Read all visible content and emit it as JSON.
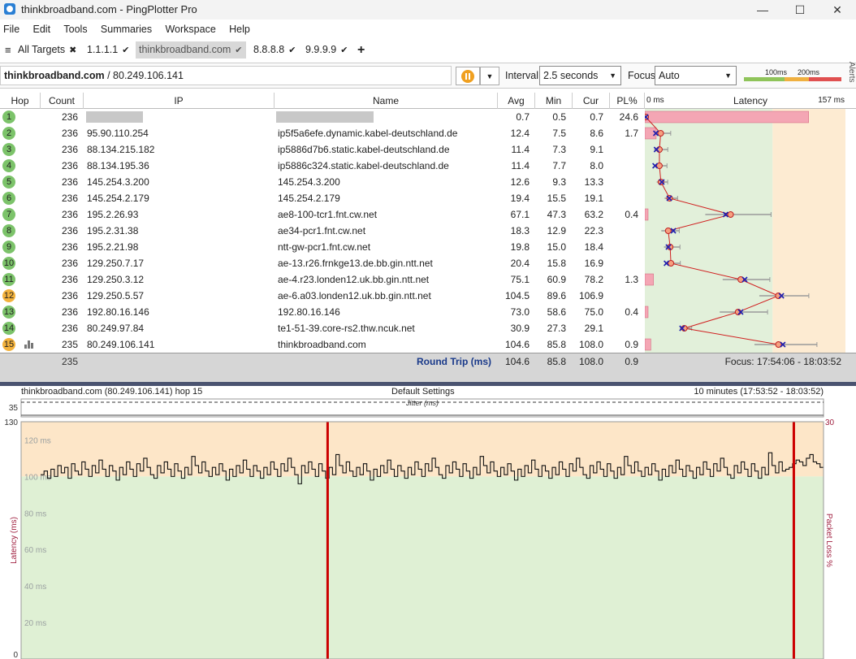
{
  "window": {
    "title": "thinkbroadband.com - PingPlotter Pro",
    "minimize": "—",
    "maximize": "☐",
    "close": "✕"
  },
  "menu": [
    "File",
    "Edit",
    "Tools",
    "Summaries",
    "Workspace",
    "Help"
  ],
  "tabs": [
    {
      "label": "All Targets",
      "icon": "✖"
    },
    {
      "label": "1.1.1.1",
      "icon": "✔"
    },
    {
      "label": "thinkbroadband.com",
      "icon": "✔"
    },
    {
      "label": "8.8.8.8",
      "icon": "✔"
    },
    {
      "label": "9.9.9.9",
      "icon": "✔"
    },
    {
      "label": "+",
      "icon": ""
    }
  ],
  "target": {
    "host": "thinkbroadband.com",
    "ip": " / 80.249.106.141",
    "interval_label": "Interval",
    "interval_value": "2.5 seconds",
    "focus_label": "Focus",
    "focus_value": "Auto",
    "scale_100": "100ms",
    "scale_200": "200ms",
    "alerts": "Alerts"
  },
  "colors": {
    "green": "#6cbf4c",
    "orange": "#f0b030",
    "red": "#e04040",
    "latency_green": "#e2f0da",
    "latency_orange": "#fdebd2",
    "graph_line": "#cc0000"
  },
  "table": {
    "headers": {
      "hop": "Hop",
      "count": "Count",
      "ip": "IP",
      "name": "Name",
      "avg": "Avg",
      "min": "Min",
      "cur": "Cur",
      "pl": "PL%",
      "latency": "Latency"
    },
    "latency_min_label": "0 ms",
    "latency_max_label": "157 ms",
    "rows": [
      {
        "hop": "1",
        "count": "236",
        "ip": "",
        "name": "",
        "avg": "0.7",
        "min": "0.5",
        "cur": "0.7",
        "pl": "24.6",
        "status": "green",
        "redacted": true
      },
      {
        "hop": "2",
        "count": "236",
        "ip": "95.90.110.254",
        "name": "ip5f5a6efe.dynamic.kabel-deutschland.de",
        "avg": "12.4",
        "min": "7.5",
        "cur": "8.6",
        "pl": "1.7",
        "status": "green"
      },
      {
        "hop": "3",
        "count": "236",
        "ip": "88.134.215.182",
        "name": "ip5886d7b6.static.kabel-deutschland.de",
        "avg": "11.4",
        "min": "7.3",
        "cur": "9.1",
        "pl": "",
        "status": "green"
      },
      {
        "hop": "4",
        "count": "236",
        "ip": "88.134.195.36",
        "name": "ip5886c324.static.kabel-deutschland.de",
        "avg": "11.4",
        "min": "7.7",
        "cur": "8.0",
        "pl": "",
        "status": "green"
      },
      {
        "hop": "5",
        "count": "236",
        "ip": "145.254.3.200",
        "name": "145.254.3.200",
        "avg": "12.6",
        "min": "9.3",
        "cur": "13.3",
        "pl": "",
        "status": "green"
      },
      {
        "hop": "6",
        "count": "236",
        "ip": "145.254.2.179",
        "name": "145.254.2.179",
        "avg": "19.4",
        "min": "15.5",
        "cur": "19.1",
        "pl": "",
        "status": "green"
      },
      {
        "hop": "7",
        "count": "236",
        "ip": "195.2.26.93",
        "name": "ae8-100-tcr1.fnt.cw.net",
        "avg": "67.1",
        "min": "47.3",
        "cur": "63.2",
        "pl": "0.4",
        "status": "green"
      },
      {
        "hop": "8",
        "count": "236",
        "ip": "195.2.31.38",
        "name": "ae34-pcr1.fnt.cw.net",
        "avg": "18.3",
        "min": "12.9",
        "cur": "22.3",
        "pl": "",
        "status": "green"
      },
      {
        "hop": "9",
        "count": "236",
        "ip": "195.2.21.98",
        "name": "ntt-gw-pcr1.fnt.cw.net",
        "avg": "19.8",
        "min": "15.0",
        "cur": "18.4",
        "pl": "",
        "status": "green"
      },
      {
        "hop": "10",
        "count": "236",
        "ip": "129.250.7.17",
        "name": "ae-13.r26.frnkge13.de.bb.gin.ntt.net",
        "avg": "20.4",
        "min": "15.8",
        "cur": "16.9",
        "pl": "",
        "status": "green"
      },
      {
        "hop": "11",
        "count": "236",
        "ip": "129.250.3.12",
        "name": "ae-4.r23.londen12.uk.bb.gin.ntt.net",
        "avg": "75.1",
        "min": "60.9",
        "cur": "78.2",
        "pl": "1.3",
        "status": "green"
      },
      {
        "hop": "12",
        "count": "236",
        "ip": "129.250.5.57",
        "name": "ae-6.a03.londen12.uk.bb.gin.ntt.net",
        "avg": "104.5",
        "min": "89.6",
        "cur": "106.9",
        "pl": "",
        "status": "orange"
      },
      {
        "hop": "13",
        "count": "236",
        "ip": "192.80.16.146",
        "name": "192.80.16.146",
        "avg": "73.0",
        "min": "58.6",
        "cur": "75.0",
        "pl": "0.4",
        "status": "green"
      },
      {
        "hop": "14",
        "count": "236",
        "ip": "80.249.97.84",
        "name": "te1-51-39.core-rs2.thw.ncuk.net",
        "avg": "30.9",
        "min": "27.3",
        "cur": "29.1",
        "pl": "",
        "status": "green"
      },
      {
        "hop": "15",
        "count": "235",
        "ip": "80.249.106.141",
        "name": "thinkbroadband.com",
        "avg": "104.6",
        "min": "85.8",
        "cur": "108.0",
        "pl": "0.9",
        "status": "orange",
        "graph_icon": true
      }
    ],
    "footer": {
      "count": "235",
      "label": "Round Trip (ms)",
      "avg": "104.6",
      "min": "85.8",
      "cur": "108.0",
      "pl": "0.9",
      "focus": "Focus: 17:54:06 - 18:03:52"
    }
  },
  "graph": {
    "title_left": "thinkbroadband.com (80.249.106.141) hop 15",
    "title_center": "Default Settings",
    "title_right": "10 minutes (17:53:52 - 18:03:52)",
    "jitter_label": "Jitter (ms)",
    "jitter_max": "35",
    "y_max": "130",
    "y_min": "0",
    "pl_max": "30",
    "y_axis_label": "Latency (ms)",
    "pl_axis_label": "Packet Loss %",
    "gridlines": [
      "120 ms",
      "100 ms",
      "80 ms",
      "60 ms",
      "40 ms",
      "20 ms"
    ]
  },
  "chart_data": {
    "type": "line",
    "ylabel": "Latency (ms)",
    "ylim": [
      0,
      130
    ],
    "orange_threshold_ms": 100,
    "loss_markers_fraction_of_timeline": [
      0.382,
      0.963
    ],
    "series": [
      {
        "name": "",
        "values": [
          101,
          103,
          99,
          104,
          100,
          106,
          102,
          105,
          99,
          107,
          103,
          101,
          108,
          104,
          100,
          106,
          102,
          109,
          104,
          100,
          106,
          103,
          98,
          105,
          101,
          108,
          104,
          100,
          107,
          103,
          110,
          105,
          101,
          99,
          106,
          102,
          108,
          104,
          100,
          107,
          103,
          99,
          105,
          101,
          111,
          106,
          102,
          108,
          103,
          100,
          105,
          101,
          107,
          103,
          98,
          104,
          100,
          106,
          102,
          109,
          104,
          100,
          106,
          103,
          99,
          105,
          101,
          108,
          104,
          100,
          107,
          103,
          110,
          105,
          101,
          96,
          106,
          102,
          108,
          104,
          100,
          107,
          103,
          99,
          105,
          101,
          112,
          106,
          102,
          108,
          103,
          100,
          105,
          101,
          107,
          103,
          98,
          104,
          100,
          106,
          102,
          109,
          104,
          100,
          106,
          103,
          99,
          105,
          101,
          108,
          104,
          100,
          107,
          103,
          110,
          105,
          101,
          99,
          106,
          102,
          108,
          104,
          100,
          107,
          103,
          99,
          105,
          101,
          111,
          106,
          102,
          108,
          103,
          100,
          105,
          101,
          107,
          103,
          98,
          104,
          100,
          106,
          102,
          109,
          104,
          100,
          106,
          103,
          99,
          105,
          101,
          108,
          104,
          100,
          107,
          103,
          110,
          105,
          101,
          99,
          106,
          102,
          108,
          104,
          100,
          107,
          103,
          99,
          105,
          101,
          111,
          106,
          102,
          108,
          103,
          100,
          105,
          101,
          107,
          103,
          98,
          104,
          100,
          106,
          102,
          109,
          104,
          100,
          106,
          103,
          99,
          105,
          101,
          108,
          104,
          100,
          107,
          103,
          110,
          105,
          101,
          99,
          106,
          102,
          108,
          104,
          100,
          107,
          103,
          99,
          105,
          101,
          113,
          106,
          102,
          108,
          103,
          104,
          105,
          107,
          109,
          108,
          106,
          110,
          112,
          108,
          107,
          105
        ]
      }
    ]
  }
}
